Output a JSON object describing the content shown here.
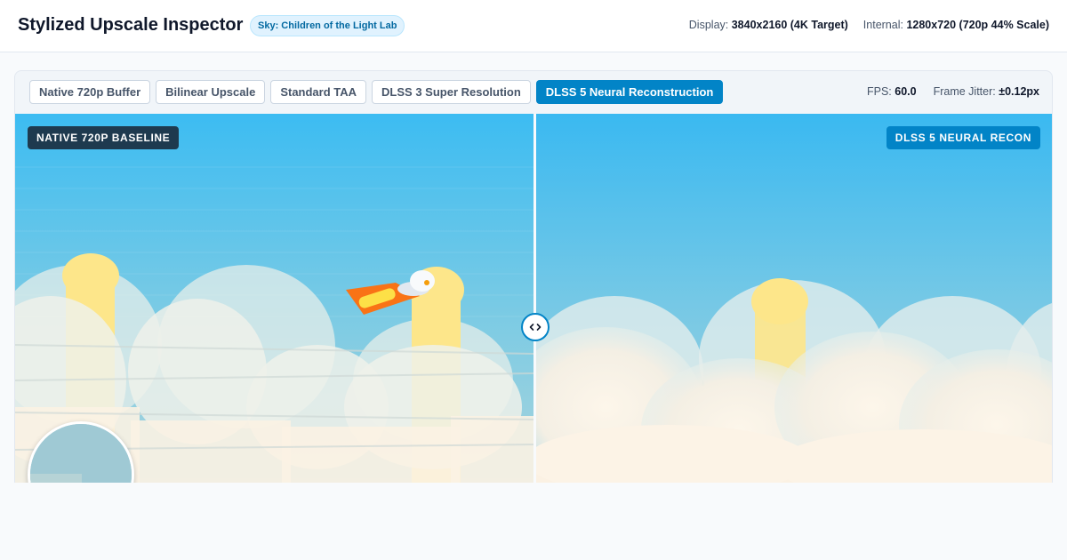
{
  "header": {
    "title": "Stylized Upscale Inspector",
    "context_badge": "Sky: Children of the Light Lab",
    "display_label": "Display:",
    "display_value": "3840x2160 (4K Target)",
    "internal_label": "Internal:",
    "internal_value": "1280x720 (720p 44% Scale)"
  },
  "toolbar": {
    "tabs": [
      {
        "label": "Native 720p Buffer",
        "active": false
      },
      {
        "label": "Bilinear Upscale",
        "active": false
      },
      {
        "label": "Standard TAA",
        "active": false
      },
      {
        "label": "DLSS 3 Super Resolution",
        "active": false
      },
      {
        "label": "DLSS 5 Neural Reconstruction",
        "active": true
      }
    ],
    "fps_label": "FPS:",
    "fps_value": "60.0",
    "jitter_label": "Frame Jitter:",
    "jitter_value": "±0.12px"
  },
  "viewport": {
    "left_label": "NATIVE 720P BASELINE",
    "right_label": "DLSS 5 NEURAL RECON",
    "split_position": 0.5,
    "slider_icon": "chevron-left-right-icon",
    "loupe_icon": "magnifier-loupe"
  },
  "colors": {
    "accent": "#0284c7",
    "chip_dark": "#1e3a4f",
    "sky_top": "#38bdf8",
    "sky_bottom": "#9fd0dc",
    "cloud": "#fdf4e7",
    "pillar": "#fde68a",
    "comet": "#f97316"
  }
}
